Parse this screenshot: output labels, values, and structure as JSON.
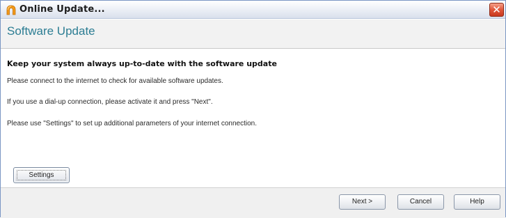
{
  "window": {
    "title": "Online Update...",
    "close_label": "✕"
  },
  "header": {
    "title": "Software Update"
  },
  "body": {
    "heading": "Keep your system always up-to-date with the software update",
    "paragraphs": [
      "Please connect to the internet to check for available software updates.",
      "If you use a dial-up connection, please activate it and press \"Next\".",
      "Please use \"Settings\" to set up additional parameters of your internet connection."
    ],
    "settings_label": "Settings"
  },
  "footer": {
    "next_label": "Next >",
    "cancel_label": "Cancel",
    "help_label": "Help"
  },
  "icons": {
    "app": "update-app-icon",
    "close": "close-icon"
  },
  "colors": {
    "accent": "#2c7d93",
    "close_button": "#e0573b",
    "app_icon": "#f29a1a"
  }
}
